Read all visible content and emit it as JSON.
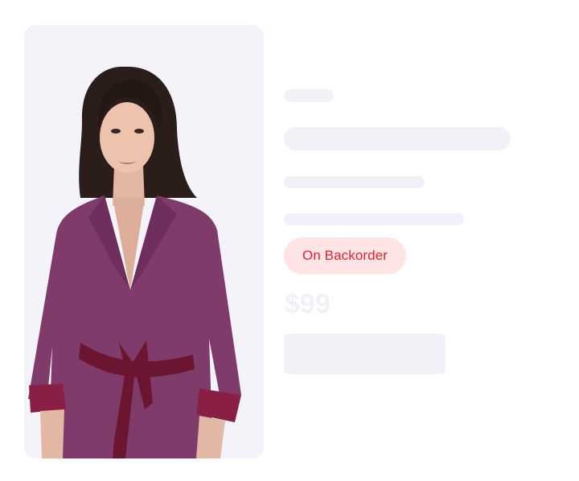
{
  "product": {
    "image_icon": "person-portrait",
    "availability_badge": "On Backorder",
    "price": "$99",
    "badge_colors": {
      "background": "#ffe4e6",
      "text": "#e0242f"
    },
    "skeleton_color": "#f2f1f7"
  }
}
